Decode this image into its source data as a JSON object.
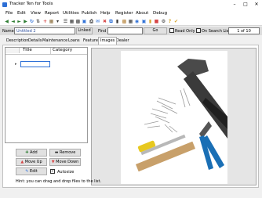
{
  "window": {
    "title": "Tracker Ten for Tools"
  },
  "menu": [
    "File",
    "Edit",
    "View",
    "Report",
    "Utilities",
    "Publish",
    "Help",
    "Register",
    "About",
    "Debug"
  ],
  "record": {
    "name_label": "Name",
    "name_value": "Untitled 2",
    "linked_label": "Linked",
    "find_label": "Find",
    "find_value": "",
    "go_label": "Go",
    "read_only_label": "Read Only",
    "on_search_list_label": "On Search List",
    "counter": "1 of 10"
  },
  "tabs": [
    "Description",
    "Details",
    "Maintenance",
    "Loans",
    "Features",
    "Images",
    "Dealer"
  ],
  "active_tab": "Images",
  "images_grid": {
    "columns": [
      "Title",
      "Category"
    ],
    "rows": [
      {
        "title": "",
        "category": ""
      }
    ]
  },
  "actions": {
    "add": "Add",
    "remove": "Remove",
    "move_up": "Move Up",
    "move_down": "Move Down",
    "edit": "Edit",
    "autosize": "Autosize",
    "autosize_checked": true
  },
  "hint": "Hint: you can drag and drop files to the list.",
  "colors": {
    "accent": "#2d6fd6",
    "tool_handle": "#c8a06a",
    "tool_head": "#4a4a4a",
    "plier_grip": "#1a6fb5",
    "screwdriver_handle": "#e7c81f"
  }
}
